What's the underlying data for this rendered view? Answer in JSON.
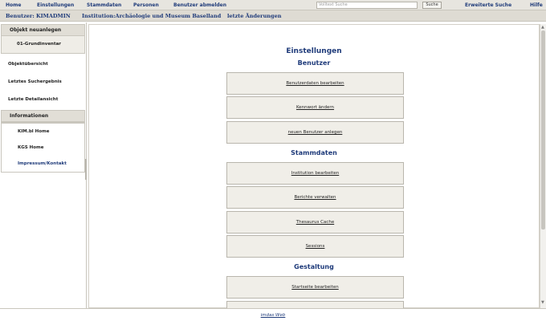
{
  "topnav": {
    "home": "Home",
    "einstellungen": "Einstellungen",
    "stammdaten": "Stammdaten",
    "personen": "Personen",
    "abmelden": "Benutzer abmelden",
    "search_placeholder": "Volltext Suche",
    "search_button": "Suche",
    "erweiterte_suche": "Erweiterte Suche",
    "hilfe": "Hilfe"
  },
  "userbar": {
    "benutzer": "Benutzer: KIMADMIN",
    "institution": "Institution:Archäologie und Museum Baselland",
    "aenderungen": "letzte Änderungen"
  },
  "sidebar": {
    "objekt_neuanlegen": "Objekt neuanlegen",
    "grundinventar": "01-Grundinventar",
    "items": [
      "Objektübersicht",
      "Letztes Suchergebnis",
      "Letzte Detailansicht"
    ],
    "informationen": "Informationen",
    "links": [
      "KIM.bl Home",
      "KGS Home",
      "Impressum/Kontakt"
    ]
  },
  "main": {
    "title": "Einstellungen",
    "sections": [
      {
        "heading": "Benutzer",
        "buttons": [
          "Benutzerdaten bearbeiten",
          "Kennwort ändern",
          "neuen Benutzer anlegen"
        ]
      },
      {
        "heading": "Stammdaten",
        "buttons": [
          "Institution bearbeiten",
          "Berichte verwalten",
          "Thesaurus Cache",
          "Sessions"
        ]
      },
      {
        "heading": "Gestaltung",
        "buttons": [
          "Startseite bearbeiten",
          ""
        ]
      }
    ]
  },
  "footer": {
    "link": "imdas Web"
  }
}
